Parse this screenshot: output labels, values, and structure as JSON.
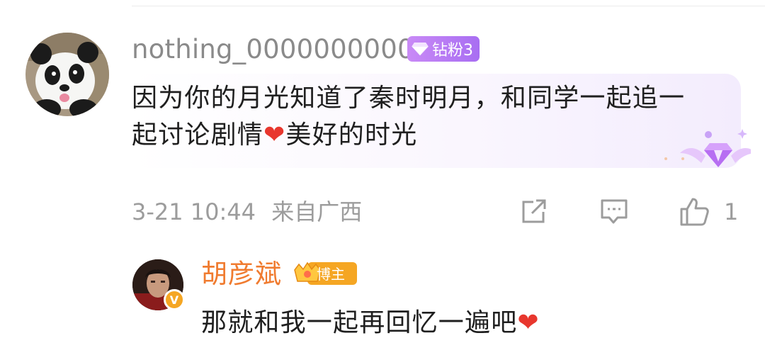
{
  "comment": {
    "username": "nothing_0000000000",
    "fan_badge_label": "钻粉3",
    "text_line1": "因为你的月光知道了秦时明月，和同学一起追一",
    "text_line2_a": "起讨论剧情",
    "heart": "❤",
    "text_line2_b": "美好的时光",
    "timestamp": "3-21 10:44",
    "location": "来自广西",
    "like_count": "1"
  },
  "reply": {
    "author": "胡彦斌",
    "host_badge_label": "博主",
    "verified_mark": "V",
    "text": "那就和我一起再回忆一遍吧",
    "heart": "❤"
  },
  "icons": {
    "share": "share-icon",
    "comment": "comment-icon",
    "like": "thumbs-up-icon",
    "fan_gem": "diamond-icon",
    "crown": "crown-icon"
  },
  "colors": {
    "username": "#8a8a8a",
    "author": "#f07b2f",
    "fan_badge": "#b57af4",
    "heart": "#e8372e"
  }
}
